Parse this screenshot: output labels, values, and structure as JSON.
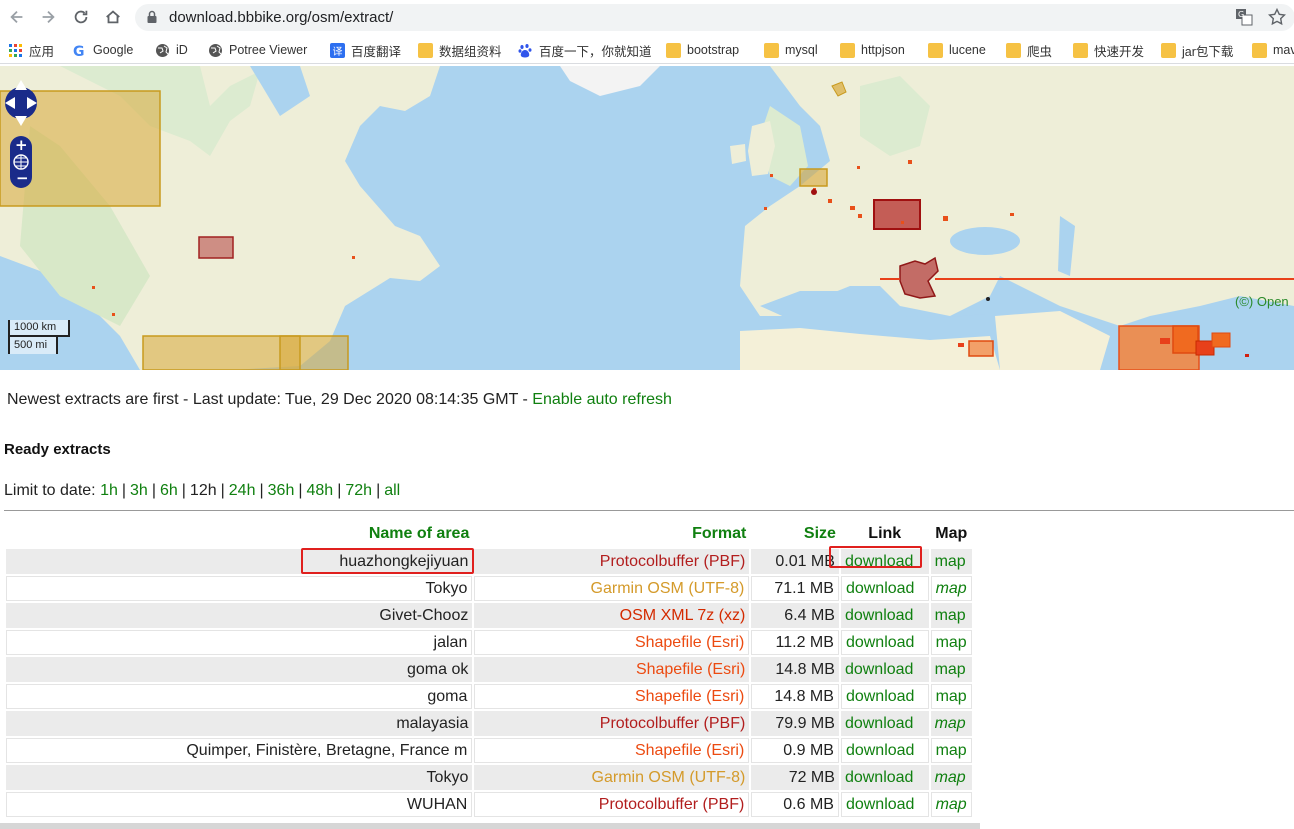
{
  "browser": {
    "url": "download.bbbike.org/osm/extract/",
    "bookmarks": [
      {
        "label": "应用",
        "icon": "apps-icon"
      },
      {
        "label": "Google",
        "icon": "google-icon"
      },
      {
        "label": "iD",
        "icon": "globe-icon"
      },
      {
        "label": "Potree Viewer",
        "icon": "globe-icon"
      },
      {
        "label": "百度翻译",
        "icon": "translate-icon"
      },
      {
        "label": "数据组资料",
        "icon": "folder-icon"
      },
      {
        "label": "百度一下，你就知道",
        "icon": "baidu-icon"
      },
      {
        "label": "bootstrap",
        "icon": "folder-icon"
      },
      {
        "label": "mysql",
        "icon": "folder-icon"
      },
      {
        "label": "httpjson",
        "icon": "folder-icon"
      },
      {
        "label": "lucene",
        "icon": "folder-icon"
      },
      {
        "label": "爬虫",
        "icon": "folder-icon"
      },
      {
        "label": "快速开发",
        "icon": "folder-icon"
      },
      {
        "label": "jar包下载",
        "icon": "folder-icon"
      },
      {
        "label": "mav",
        "icon": "folder-icon"
      }
    ]
  },
  "map": {
    "scale_km": "1000 km",
    "scale_mi": "500 mi",
    "attribution": "(©) Open"
  },
  "page": {
    "status_prefix": "Newest extracts are first - Last update: Tue, 29 Dec 2020 08:14:35 GMT - ",
    "auto_refresh_link": "Enable auto refresh",
    "ready_heading": "Ready extracts",
    "limit_label": "Limit to date:",
    "limit_options": [
      "1h",
      "3h",
      "6h",
      "12h",
      "24h",
      "36h",
      "48h",
      "72h",
      "all"
    ],
    "limit_selected": "12h"
  },
  "table": {
    "headers": {
      "name": "Name of area",
      "format": "Format",
      "size": "Size",
      "link": "Link",
      "map": "Map"
    },
    "rows": [
      {
        "name": "huazhongkejiyuan",
        "format": "Protocolbuffer (PBF)",
        "size": "0.01 MB",
        "link": "download",
        "map": "map"
      },
      {
        "name": "Tokyo",
        "format": "Garmin OSM (UTF-8)",
        "size": "71.1 MB",
        "link": "download",
        "map": "map"
      },
      {
        "name": "Givet-Chooz",
        "format": "OSM XML 7z (xz)",
        "size": "6.4 MB",
        "link": "download",
        "map": "map"
      },
      {
        "name": "jalan",
        "format": "Shapefile (Esri)",
        "size": "11.2 MB",
        "link": "download",
        "map": "map"
      },
      {
        "name": "goma ok",
        "format": "Shapefile (Esri)",
        "size": "14.8 MB",
        "link": "download",
        "map": "map"
      },
      {
        "name": "goma",
        "format": "Shapefile (Esri)",
        "size": "14.8 MB",
        "link": "download",
        "map": "map"
      },
      {
        "name": "malayasia",
        "format": "Protocolbuffer (PBF)",
        "size": "79.9 MB",
        "link": "download",
        "map": "map"
      },
      {
        "name": "Quimper, Finistère, Bretagne, France m",
        "format": "Shapefile (Esri)",
        "size": "0.9 MB",
        "link": "download",
        "map": "map"
      },
      {
        "name": "Tokyo",
        "format": "Garmin OSM (UTF-8)",
        "size": "72 MB",
        "link": "download",
        "map": "map"
      },
      {
        "name": "WUHAN",
        "format": "Protocolbuffer (PBF)",
        "size": "0.6 MB",
        "link": "download",
        "map": "map"
      }
    ]
  },
  "colors": {
    "pbf": "#b21e1e",
    "garmin": "#d49a2a",
    "osmxml": "#d42a00",
    "shapefile": "#ec4a10",
    "link_green": "#108010",
    "highlight": "#e0201e"
  }
}
